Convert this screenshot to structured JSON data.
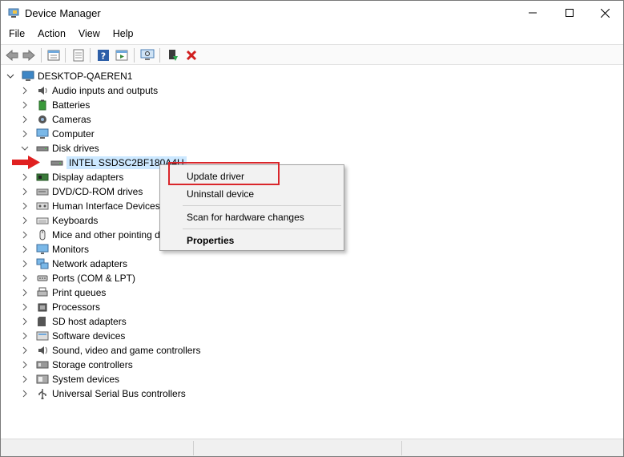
{
  "window": {
    "title": "Device Manager"
  },
  "menu": [
    "File",
    "Action",
    "View",
    "Help"
  ],
  "toolbar": {
    "buttons": [
      "back-icon",
      "forward-icon",
      "properties-view-icon",
      "list-icon",
      "help-icon",
      "run-icon",
      "scan-monitor-icon",
      "update-driver-icon",
      "uninstall-icon"
    ]
  },
  "tree": {
    "root": "DESKTOP-QAEREN1",
    "categories": [
      "Audio inputs and outputs",
      "Batteries",
      "Cameras",
      "Computer",
      "Disk drives",
      "Display adapters",
      "DVD/CD-ROM drives",
      "Human Interface Devices",
      "Keyboards",
      "Mice and other pointing devices",
      "Monitors",
      "Network adapters",
      "Ports (COM & LPT)",
      "Print queues",
      "Processors",
      "SD host adapters",
      "Software devices",
      "Sound, video and game controllers",
      "Storage controllers",
      "System devices",
      "Universal Serial Bus controllers"
    ],
    "selected_device": "INTEL SSDSC2BF180A4H"
  },
  "context_menu": {
    "items": [
      "Update driver",
      "Uninstall device",
      "Scan for hardware changes",
      "Properties"
    ]
  },
  "colors": {
    "highlight_border": "#d9262b",
    "selection_bg": "#cce8ff",
    "arrow": "#e02020"
  }
}
